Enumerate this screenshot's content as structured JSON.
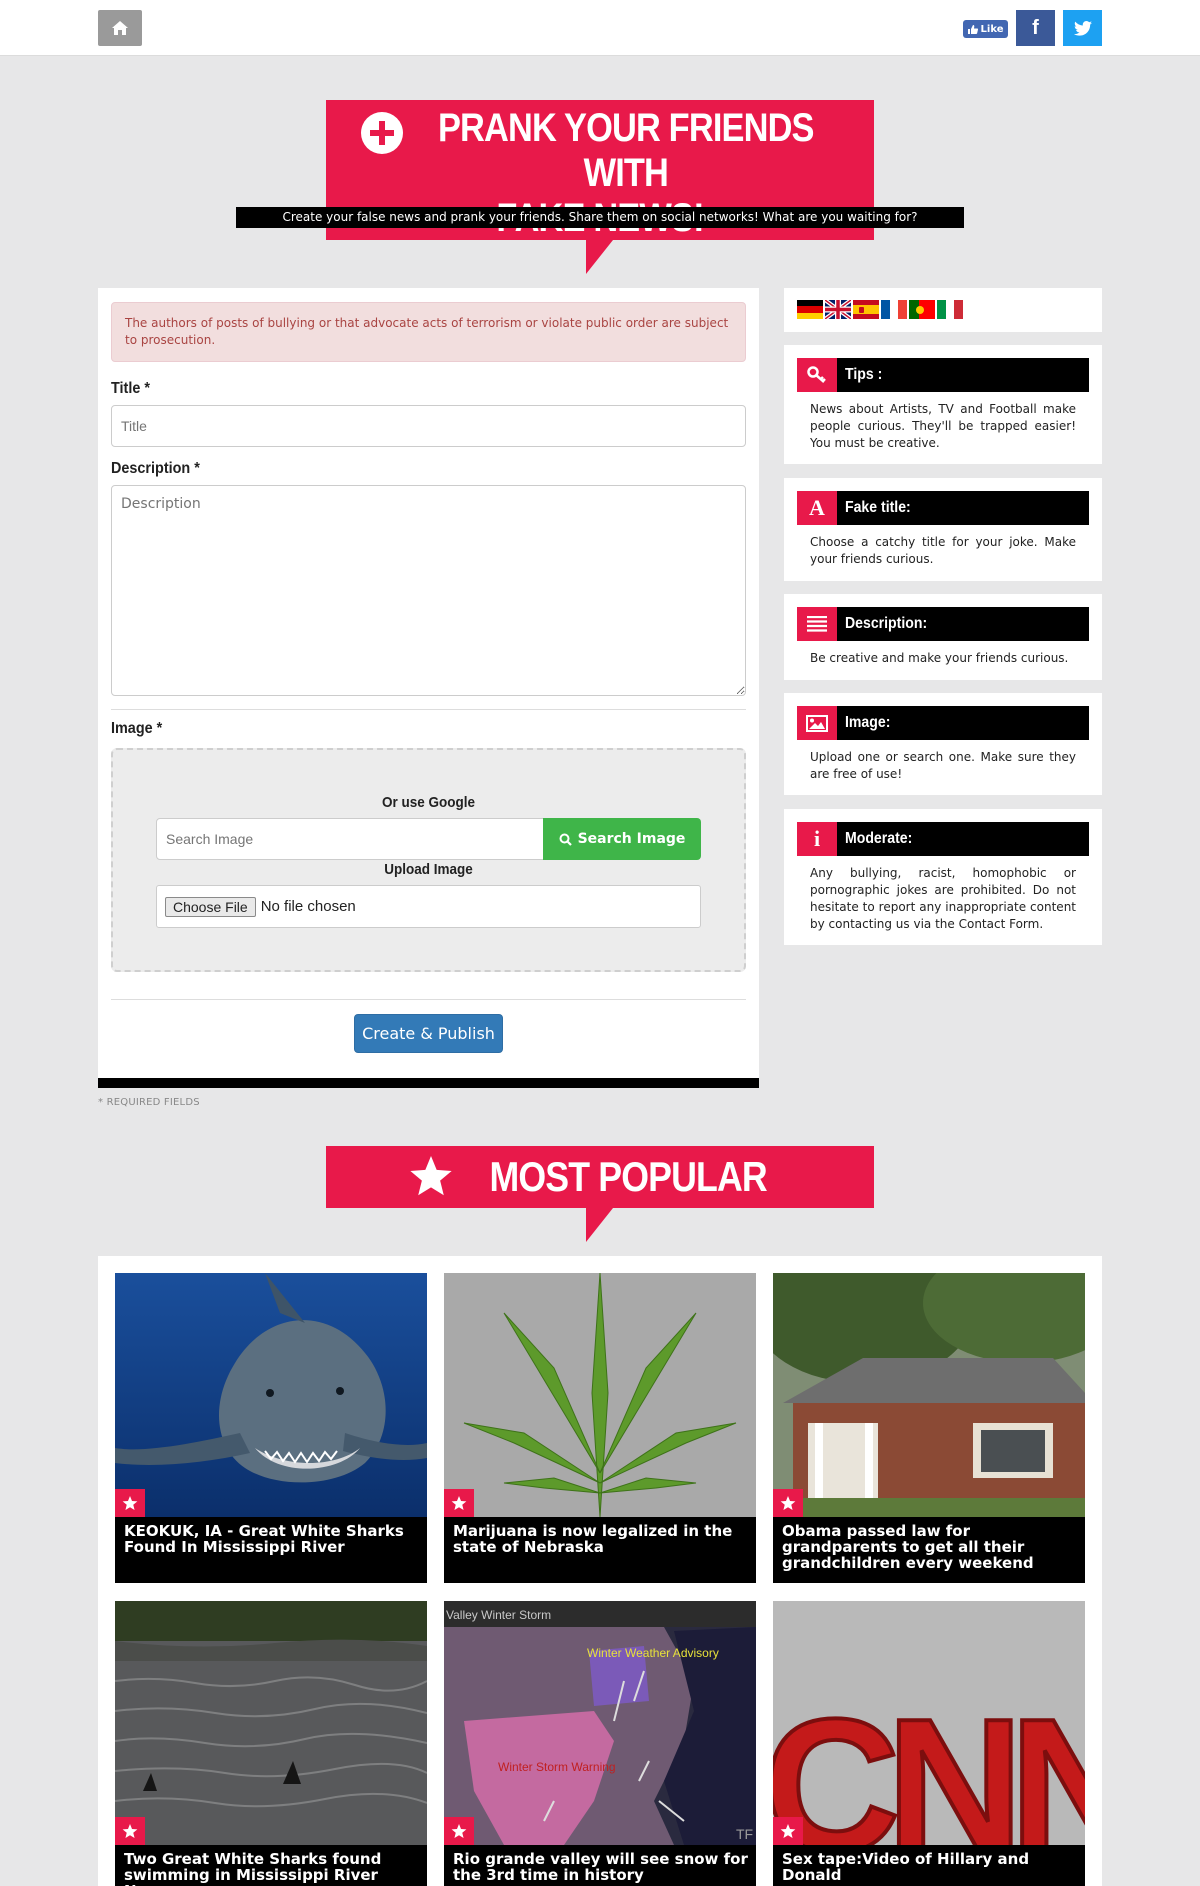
{
  "header": {
    "like_label": "Like",
    "facebook_icon": "facebook-icon",
    "twitter_icon": "twitter-icon",
    "home_icon": "home-icon"
  },
  "hero": {
    "title_line1": "PRANK YOUR FRIENDS WITH",
    "title_line2": "FAKE NEWS!",
    "subtitle": "Create your false news and prank your friends. Share them on social networks! What are you waiting for?"
  },
  "form": {
    "alert": "The authors of posts of bullying or that advocate acts of terrorism or violate public order are subject to prosecution.",
    "title_label": "Title *",
    "title_placeholder": "Title",
    "description_label": "Description *",
    "description_placeholder": "Description",
    "image_label": "Image *",
    "google_label": "Or use Google",
    "search_placeholder": "Search Image",
    "search_button": "Search Image",
    "upload_label": "Upload Image",
    "choose_file": "Choose File",
    "no_file": "No file chosen",
    "publish_button": "Create & Publish",
    "required_note": "* REQUIRED FIELDS"
  },
  "sidebar": {
    "flags": [
      "German",
      "English",
      "Spanish",
      "French",
      "Portuguese",
      "Italian"
    ],
    "tips": [
      {
        "title": "Tips :",
        "icon": "key-icon",
        "text": "News about Artists, TV and Football make people curious. They'll be trapped easier! You must be creative."
      },
      {
        "title": "Fake title:",
        "icon": "font-icon",
        "text": "Choose a catchy title for your joke. Make your friends curious."
      },
      {
        "title": "Description:",
        "icon": "lines-icon",
        "text": "Be creative and make your friends curious."
      },
      {
        "title": "Image:",
        "icon": "picture-icon",
        "text": "Upload one or search one. Make sure they are free of use!"
      },
      {
        "title": "Moderate:",
        "icon": "info-icon",
        "text": "Any bullying, racist, homophobic or pornographic jokes are prohibited. Do not hesitate to report any inappropriate content by contacting us via the Contact Form."
      }
    ]
  },
  "popular": {
    "heading": "MOST POPULAR",
    "articles": [
      {
        "title": "KEOKUK, IA - Great White Sharks Found In Mississippi River"
      },
      {
        "title": "Marijuana is now legalized in the state of Nebraska"
      },
      {
        "title": "Obama passed law for grandparents to get all their grandchildren every weekend"
      },
      {
        "title": "Two Great White Sharks found swimming in Mississippi River Near"
      },
      {
        "title": "Rio grande valley will see snow for the 3rd time in history"
      },
      {
        "title": "Sex tape:Video of Hillary and Donald"
      }
    ],
    "image_texts": {
      "map_header": "Valley Winter Storm",
      "map_advisory": "Winter Weather Advisory",
      "map_warning": "Winter Storm Warning",
      "map_corner": "TF",
      "logo": "CNN"
    }
  },
  "colors": {
    "brand": "#e8194a",
    "search": "#3fb549",
    "publish": "#337ab7",
    "facebook": "#3b5998",
    "twitter": "#1da1f2"
  }
}
